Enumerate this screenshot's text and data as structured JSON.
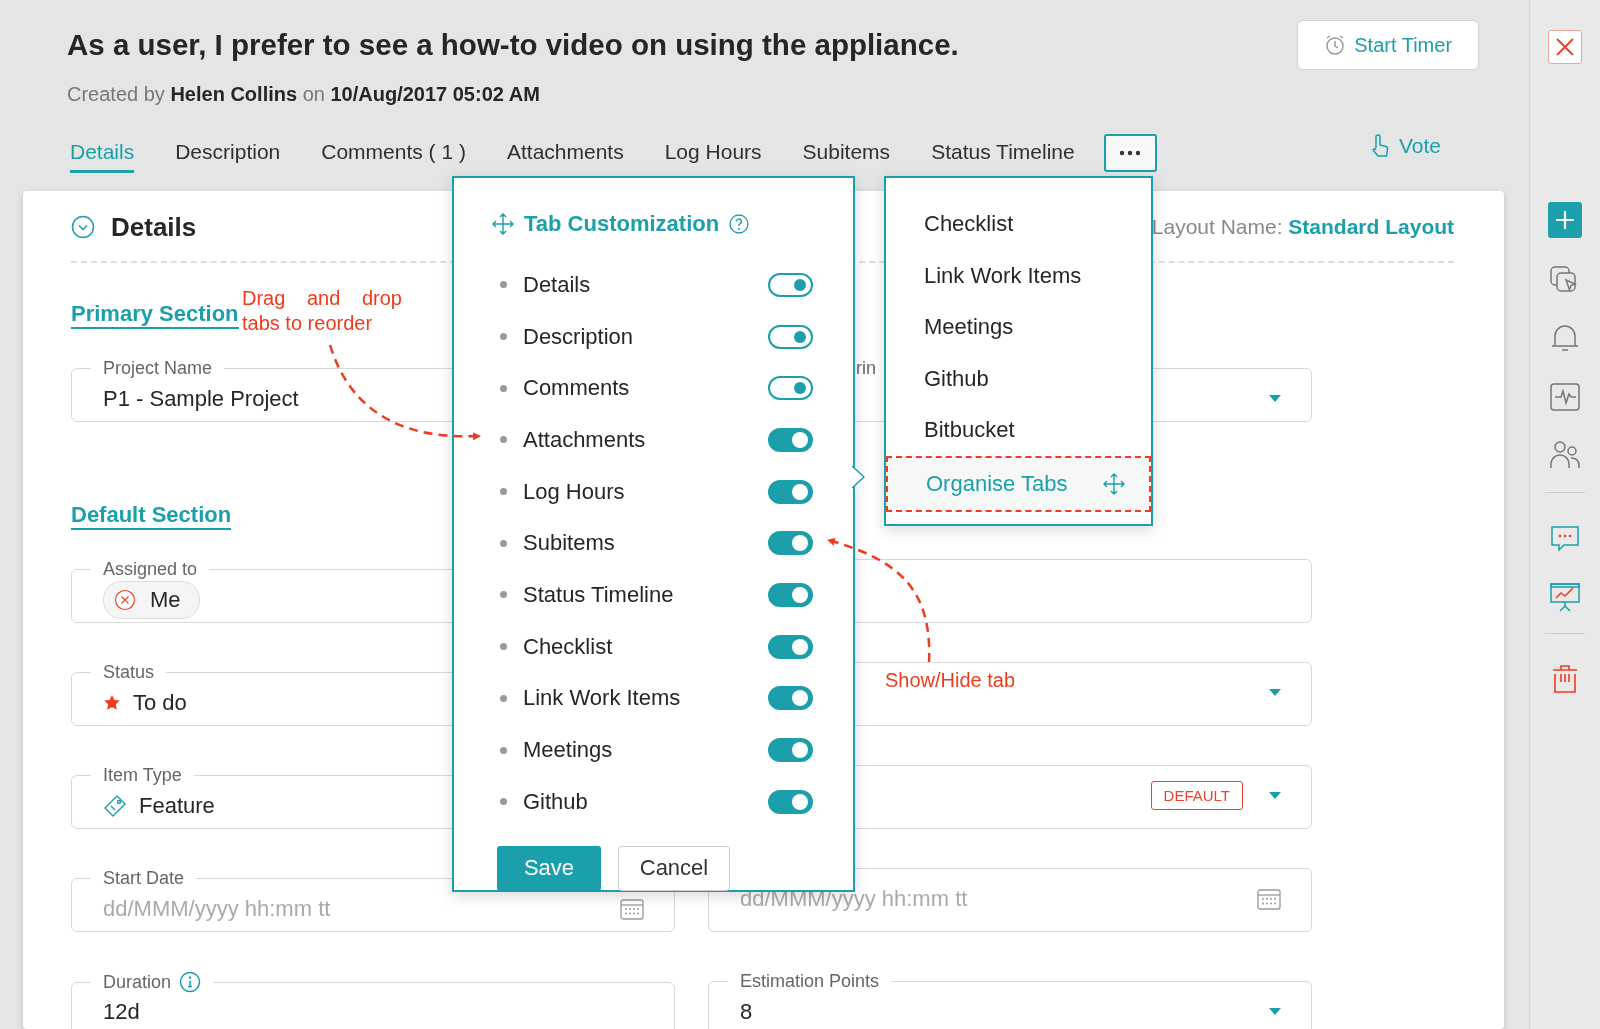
{
  "header": {
    "title": "As a user, I prefer to see a how-to video on using the appliance.",
    "created_prefix": "Created by",
    "author": "Helen Collins",
    "on": "on",
    "date": "10/Aug/2017 05:02 AM",
    "timer_button": "Start Timer"
  },
  "tabs": [
    {
      "label": "Details",
      "selected": true
    },
    {
      "label": "Description",
      "selected": false
    },
    {
      "label": "Comments ( 1 )",
      "selected": false
    },
    {
      "label": "Attachments",
      "selected": false
    },
    {
      "label": "Log Hours",
      "selected": false
    },
    {
      "label": "Subitems",
      "selected": false
    },
    {
      "label": "Status Timeline",
      "selected": false
    }
  ],
  "vote": "Vote",
  "details": {
    "title": "Details",
    "layout_label": "Layout Name:",
    "layout_name": "Standard Layout",
    "sections": [
      {
        "title": "Primary Section",
        "fields": [
          {
            "label": "Project Name",
            "kind": "text",
            "value": "P1 - Sample Project"
          },
          {
            "label": "rin",
            "kind": "select"
          }
        ]
      },
      {
        "title": "Default Section",
        "fields": [
          {
            "label": "Assigned to",
            "kind": "user_chip",
            "value": "Me"
          },
          {
            "kind": "blank"
          },
          {
            "label": "Status",
            "kind": "status",
            "value": "To do"
          },
          {
            "kind": "select"
          },
          {
            "label": "Item Type",
            "kind": "item_type",
            "value": "Feature"
          },
          {
            "kind": "select",
            "badge": "DEFAULT"
          },
          {
            "label": "Start Date",
            "kind": "date",
            "placeholder": "dd/MMM/yyyy hh:mm tt"
          },
          {
            "kind": "date",
            "placeholder": "dd/MMM/yyyy hh:mm tt"
          },
          {
            "label": "Duration",
            "kind": "text",
            "info": true,
            "value": "12d"
          },
          {
            "label": "Estimation Points",
            "kind": "select",
            "value": "8"
          }
        ]
      }
    ]
  },
  "popup": {
    "title": "Tab Customization",
    "items": [
      {
        "label": "Details",
        "on": true,
        "disabled": true
      },
      {
        "label": "Description",
        "on": true,
        "disabled": true
      },
      {
        "label": "Comments",
        "on": true,
        "disabled": true
      },
      {
        "label": "Attachments",
        "on": true,
        "disabled": false
      },
      {
        "label": "Log Hours",
        "on": true,
        "disabled": false
      },
      {
        "label": "Subitems",
        "on": true,
        "disabled": false
      },
      {
        "label": "Status Timeline",
        "on": true,
        "disabled": false
      },
      {
        "label": "Checklist",
        "on": true,
        "disabled": false
      },
      {
        "label": "Link Work Items",
        "on": true,
        "disabled": false
      },
      {
        "label": "Meetings",
        "on": true,
        "disabled": false
      },
      {
        "label": "Github",
        "on": true,
        "disabled": false
      }
    ],
    "save": "Save",
    "cancel": "Cancel"
  },
  "menu": {
    "items": [
      "Checklist",
      "Link Work Items",
      "Meetings",
      "Github",
      "Bitbucket"
    ],
    "organise": "Organise Tabs"
  },
  "annotations": [
    {
      "text": "Drag and drop tabs to reorder"
    },
    {
      "text": "Show/Hide tab"
    }
  ]
}
